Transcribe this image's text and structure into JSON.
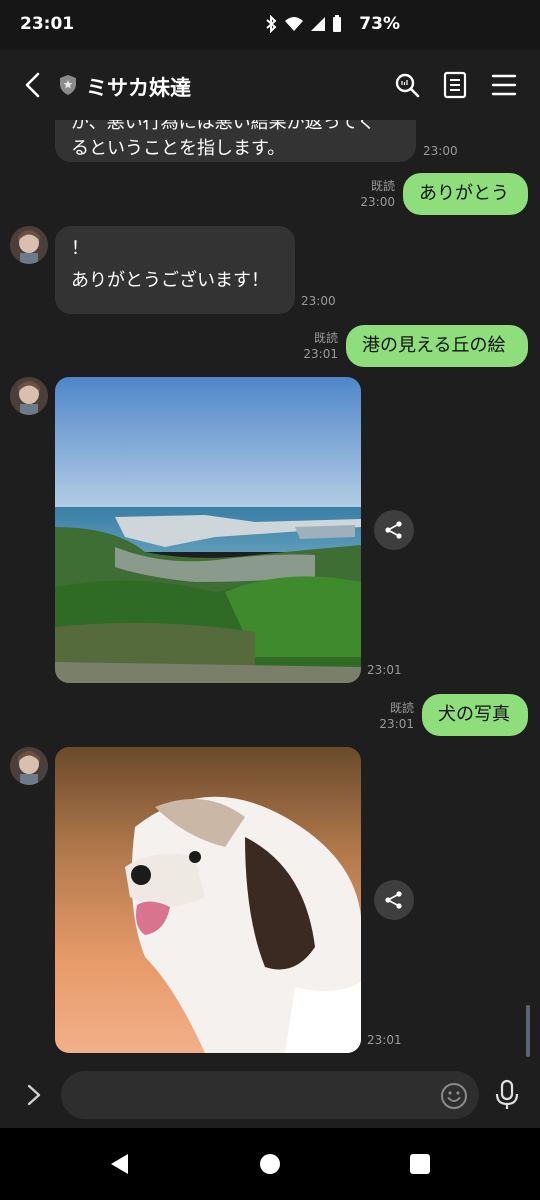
{
  "status_bar": {
    "time": "23:01",
    "battery": "73%",
    "icons": [
      "bluetooth-icon",
      "wifi-icon",
      "signal-icon",
      "battery-icon"
    ]
  },
  "header": {
    "back_icon": "chevron-left-icon",
    "title": "ミサカ妹達",
    "icons": [
      "search-icon",
      "notes-icon",
      "menu-icon"
    ]
  },
  "messages": {
    "m1": {
      "text_line1": "が、悪い行為には悪い結果が返ってく",
      "text_line2": "るということを指します。",
      "time": "23:00"
    },
    "m2": {
      "read": "既読",
      "time": "23:00",
      "text": "ありがとう"
    },
    "m3": {
      "line1": "！",
      "line2": "ありがとうございます！",
      "time": "23:00"
    },
    "m4": {
      "read": "既読",
      "time": "23:01",
      "text": "港の見える丘の絵"
    },
    "m5": {
      "time": "23:01",
      "image": "harbor-landscape-image"
    },
    "m6": {
      "read": "既読",
      "time": "23:01",
      "text": "犬の写真"
    },
    "m7": {
      "time": "23:01",
      "image": "dog-photo-image"
    }
  },
  "input": {
    "value": "",
    "placeholder": ""
  },
  "colors": {
    "bubble_right": "#8fde7c",
    "bubble_left": "#333333",
    "background": "#1e1e1e"
  }
}
